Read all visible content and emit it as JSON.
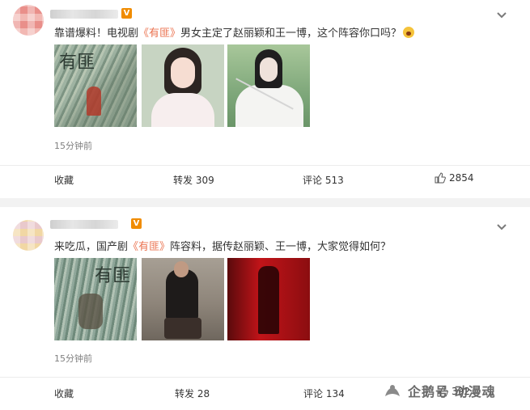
{
  "posts": [
    {
      "text_before": "靠谱爆料！电视剧",
      "highlight": "《有匪》",
      "text_after": "男女主定了赵丽颖和王一博，这个阵容你口吗？",
      "timestamp": "15分钟前",
      "images": [
        "drama-poster",
        "actress-portrait",
        "actor-portrait"
      ],
      "actions": {
        "favorite": "收藏",
        "repost": "转发 309",
        "comment": "评论 513",
        "like": "2854"
      }
    },
    {
      "text_before": "来吃瓜，国产剧",
      "highlight": "《有匪》",
      "text_after": "阵容料，据传赵丽颖、王一博，大家觉得如何？",
      "timestamp": "15分钟前",
      "images": [
        "drama-poster",
        "actress-photo",
        "actor-photo-red"
      ],
      "actions": {
        "favorite": "收藏",
        "repost": "转发 28",
        "comment": "评论 134",
        "like": "392"
      }
    }
  ],
  "watermark": {
    "text": "企鹅号 动漫魂"
  },
  "colors": {
    "highlight": "#eb7350",
    "vip_badge": "#f08c00",
    "background": "#f2f2f2"
  }
}
